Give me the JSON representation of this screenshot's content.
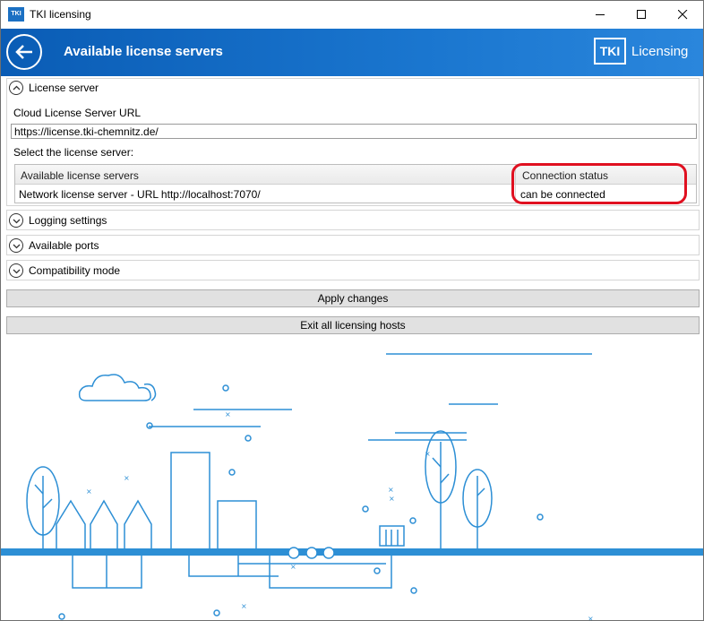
{
  "window": {
    "title": "TKI licensing",
    "icon_text": "TKI"
  },
  "header": {
    "title": "Available license servers",
    "brand_box": "TKI",
    "brand_text": "Licensing"
  },
  "license_server": {
    "section_label": "License server",
    "cloud_url_label": "Cloud License Server URL",
    "cloud_url_value": "https://license.tki-chemnitz.de/",
    "select_label": "Select the license server:",
    "columns": [
      "Available license servers",
      "Connection status"
    ],
    "rows": [
      {
        "server": "Network license server - URL http://localhost:7070/",
        "status": "can be connected"
      }
    ]
  },
  "sections": {
    "logging": "Logging settings",
    "ports": "Available ports",
    "compat": "Compatibility mode"
  },
  "buttons": {
    "apply": "Apply changes",
    "exit": "Exit all licensing hosts"
  },
  "colors": {
    "header_blue": "#1a76cf",
    "highlight_red": "#e01020",
    "illustration_blue": "#2d8fd5"
  }
}
